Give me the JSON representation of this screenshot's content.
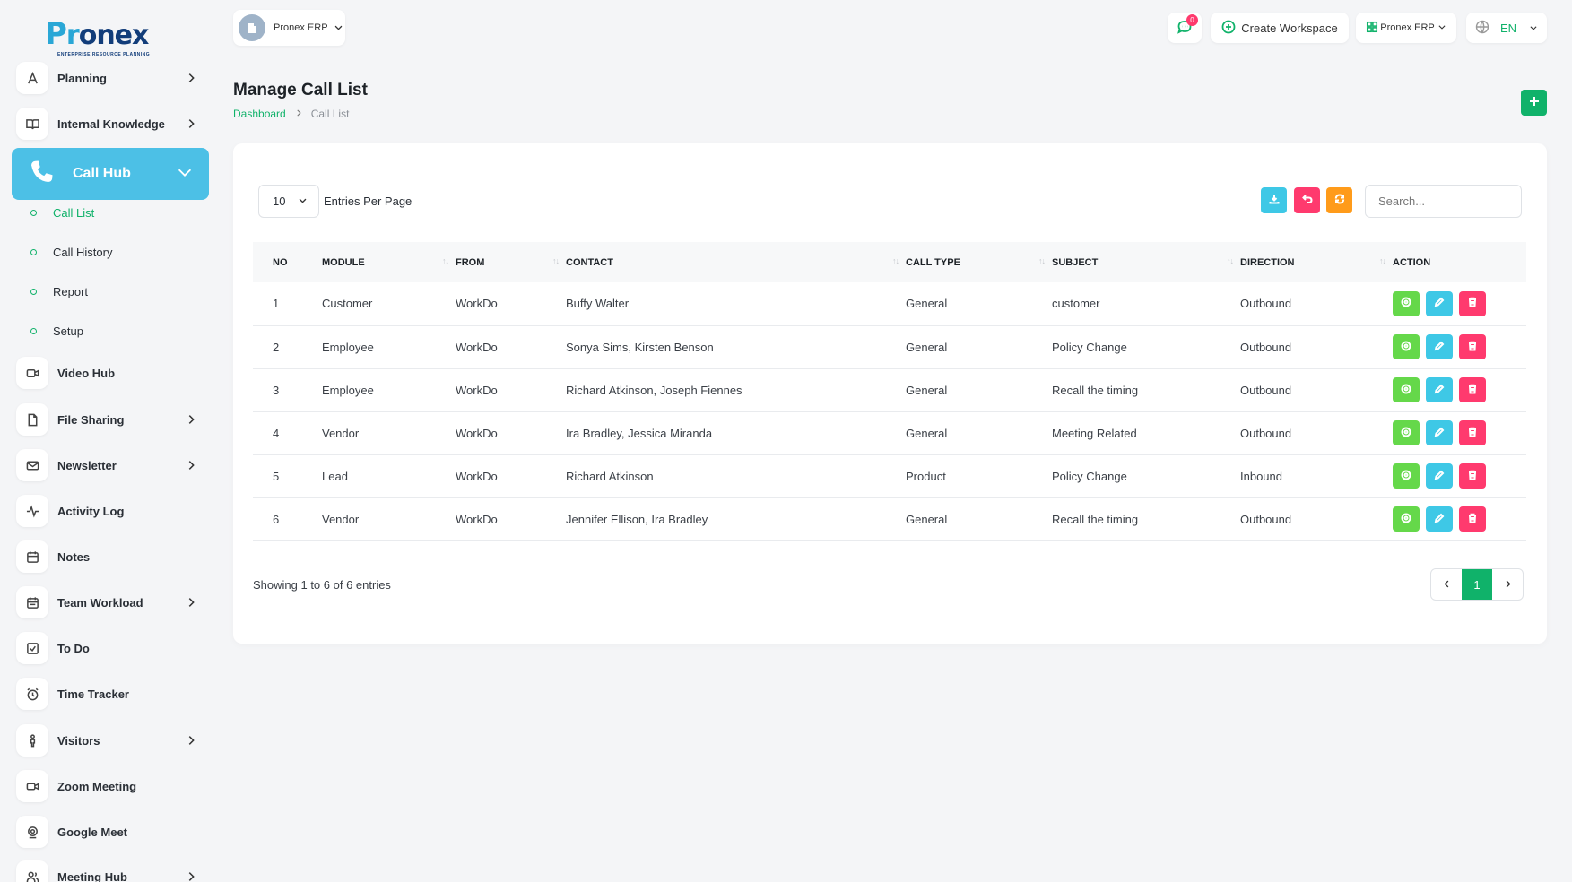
{
  "brand": {
    "logo_p": "P",
    "logo_r": "r",
    "logo_rest": "onex",
    "tagline": "ENTERPRISE RESOURCE PLANNING"
  },
  "sidebar": {
    "items_top": [
      {
        "label": "Planning",
        "icon": "planning-icon",
        "has_chevron": true
      },
      {
        "label": "Internal Knowledge",
        "icon": "book-icon",
        "has_chevron": true
      }
    ],
    "active": {
      "label": "Call Hub",
      "icon": "phone-icon"
    },
    "sub_items": [
      {
        "label": "Call List",
        "active": true
      },
      {
        "label": "Call History",
        "active": false
      },
      {
        "label": "Report",
        "active": false
      },
      {
        "label": "Setup",
        "active": false
      }
    ],
    "items_bottom": [
      {
        "label": "Video Hub",
        "icon": "video-hub-icon",
        "has_chevron": false
      },
      {
        "label": "File Sharing",
        "icon": "file-icon",
        "has_chevron": true
      },
      {
        "label": "Newsletter",
        "icon": "mail-icon",
        "has_chevron": true
      },
      {
        "label": "Activity Log",
        "icon": "activity-icon",
        "has_chevron": false
      },
      {
        "label": "Notes",
        "icon": "notes-icon",
        "has_chevron": false
      },
      {
        "label": "Team Workload",
        "icon": "calendar-icon",
        "has_chevron": true
      },
      {
        "label": "To Do",
        "icon": "checkbox-icon",
        "has_chevron": false
      },
      {
        "label": "Time Tracker",
        "icon": "alarm-icon",
        "has_chevron": false
      },
      {
        "label": "Visitors",
        "icon": "person-icon",
        "has_chevron": true
      },
      {
        "label": "Zoom Meeting",
        "icon": "camera-icon",
        "has_chevron": false
      },
      {
        "label": "Google Meet",
        "icon": "webcam-icon",
        "has_chevron": false
      },
      {
        "label": "Meeting Hub",
        "icon": "users-icon",
        "has_chevron": true
      }
    ]
  },
  "topbar": {
    "workspace_name": "Pronex ERP",
    "notification_count": "0",
    "create_workspace_label": "Create Workspace",
    "erp_label": "Pronex ERP",
    "language": "EN"
  },
  "page": {
    "title": "Manage Call List",
    "breadcrumb": {
      "home": "Dashboard",
      "current": "Call List"
    }
  },
  "table_controls": {
    "entries_value": "10",
    "entries_label": "Entries Per Page",
    "search_placeholder": "Search..."
  },
  "table": {
    "headers": [
      "NO",
      "MODULE",
      "FROM",
      "CONTACT",
      "CALL TYPE",
      "SUBJECT",
      "DIRECTION",
      "ACTION"
    ],
    "rows": [
      {
        "no": "1",
        "module": "Customer",
        "from": "WorkDo",
        "contact": "Buffy Walter",
        "call_type": "General",
        "subject": "customer",
        "direction": "Outbound"
      },
      {
        "no": "2",
        "module": "Employee",
        "from": "WorkDo",
        "contact": "Sonya Sims, Kirsten Benson",
        "call_type": "General",
        "subject": "Policy Change",
        "direction": "Outbound"
      },
      {
        "no": "3",
        "module": "Employee",
        "from": "WorkDo",
        "contact": "Richard Atkinson, Joseph Fiennes",
        "call_type": "General",
        "subject": "Recall the timing",
        "direction": "Outbound"
      },
      {
        "no": "4",
        "module": "Vendor",
        "from": "WorkDo",
        "contact": "Ira Bradley, Jessica Miranda",
        "call_type": "General",
        "subject": "Meeting Related",
        "direction": "Outbound"
      },
      {
        "no": "5",
        "module": "Lead",
        "from": "WorkDo",
        "contact": "Richard Atkinson",
        "call_type": "Product",
        "subject": "Policy Change",
        "direction": "Inbound"
      },
      {
        "no": "6",
        "module": "Vendor",
        "from": "WorkDo",
        "contact": "Jennifer Ellison, Ira Bradley",
        "call_type": "General",
        "subject": "Recall the timing",
        "direction": "Outbound"
      }
    ]
  },
  "footer": {
    "showing_text": "Showing 1 to 6 of 6 entries",
    "current_page": "1"
  },
  "colors": {
    "accent": "#10b26a",
    "call_hub": "#4cc0e6",
    "danger": "#ff3a6e",
    "warning": "#ff9b1a",
    "view": "#65d84a"
  }
}
